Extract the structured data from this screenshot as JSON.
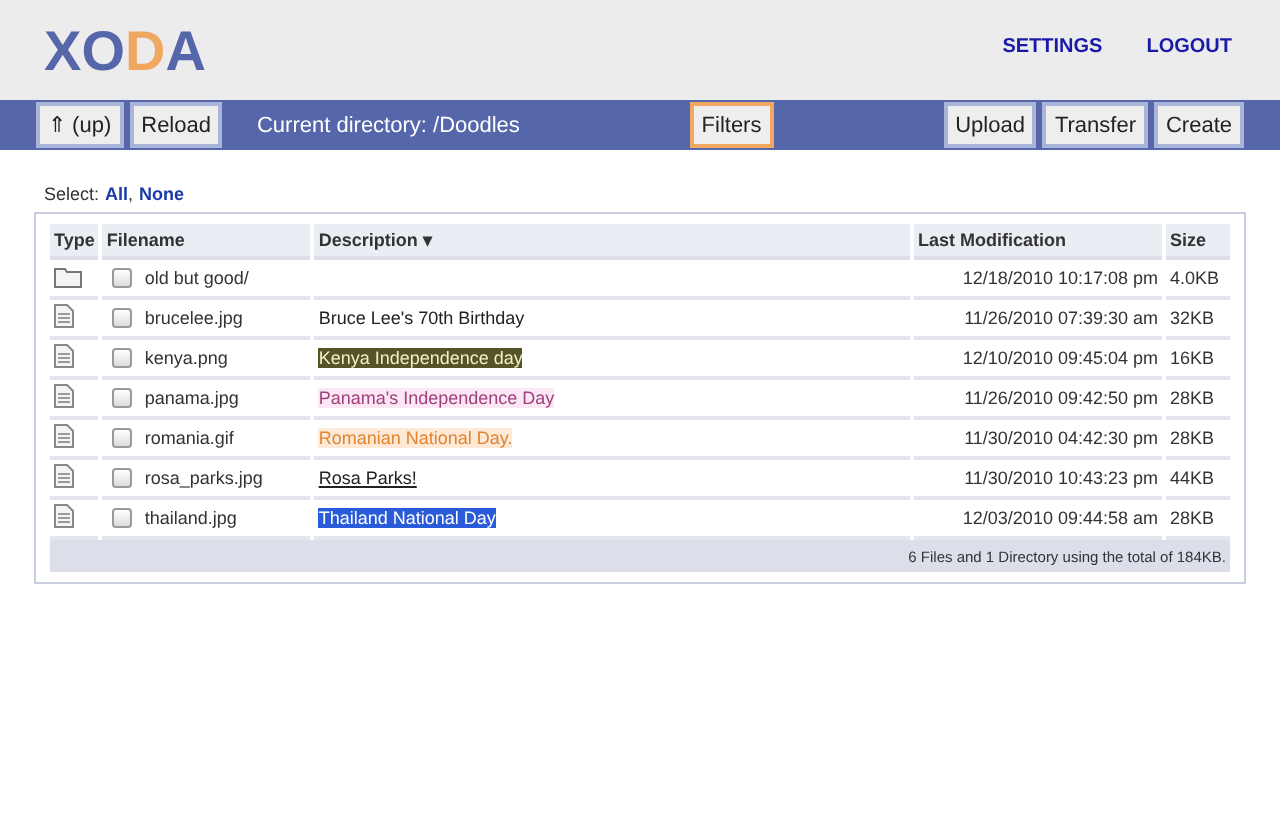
{
  "logo": [
    {
      "letter": "X",
      "color": "#5566aa"
    },
    {
      "letter": "O",
      "color": "#5566aa"
    },
    {
      "letter": "D",
      "color": "#f0a860"
    },
    {
      "letter": "A",
      "color": "#5566aa"
    }
  ],
  "nav_links": [
    "SETTINGS",
    "LOGOUT"
  ],
  "toolbar": {
    "left_buttons": [
      {
        "label": "⇑ (up)",
        "highlighted": false
      },
      {
        "label": "Reload",
        "highlighted": false
      }
    ],
    "current_directory": "Current directory: /Doodles",
    "filters": {
      "label": "Filters",
      "highlighted": true
    },
    "right_buttons": [
      {
        "label": "Upload",
        "highlighted": false
      },
      {
        "label": "Transfer",
        "highlighted": false
      },
      {
        "label": "Create",
        "highlighted": false
      }
    ]
  },
  "select": {
    "label": "Select:",
    "links": [
      "All",
      "None"
    ],
    "separator": ","
  },
  "table": {
    "columns": [
      "Type",
      "Filename",
      "Description ▾",
      "Last Modification",
      "Size"
    ],
    "rows": [
      {
        "kind": "folder",
        "filename": "old but good/",
        "checked": false,
        "modified": "12/18/2010 10:17:08 pm",
        "size": "4.0KB"
      },
      {
        "kind": "file",
        "filename": "brucelee.jpg",
        "checked": false,
        "description": {
          "text": "Bruce Lee's 70th Birthday",
          "kind": "plain"
        },
        "modified": "11/26/2010 07:39:30 am",
        "size": "32KB"
      },
      {
        "kind": "file",
        "filename": "kenya.png",
        "checked": false,
        "description": {
          "text": "Kenya Independence day",
          "kind": "highlight",
          "color": "#55532a"
        },
        "modified": "12/10/2010 09:45:04 pm",
        "size": "16KB"
      },
      {
        "kind": "file",
        "filename": "panama.jpg",
        "checked": false,
        "description": {
          "text": "Panama's Independence Day",
          "kind": "highlight",
          "color": "#fbe8f4"
        },
        "modified": "11/26/2010 09:42:50 pm",
        "size": "28KB"
      },
      {
        "kind": "file",
        "filename": "romania.gif",
        "checked": false,
        "description": {
          "text": "Romanian National Day.",
          "kind": "highlight",
          "color": "#fde9d6"
        },
        "modified": "11/30/2010 04:42:30 pm",
        "size": "28KB"
      },
      {
        "kind": "file",
        "filename": "rosa_parks.jpg",
        "checked": false,
        "description": {
          "text": "Rosa Parks!",
          "kind": "underline"
        },
        "modified": "11/30/2010 10:43:23 pm",
        "size": "44KB"
      },
      {
        "kind": "file",
        "filename": "thailand.jpg",
        "checked": false,
        "description": {
          "text": "Thailand National Day",
          "kind": "highlight",
          "color": "#2a5bd8"
        },
        "modified": "12/03/2010 09:44:58 am",
        "size": "28KB"
      }
    ],
    "summary": "6 Files and 1 Directory using the total of 184KB."
  }
}
